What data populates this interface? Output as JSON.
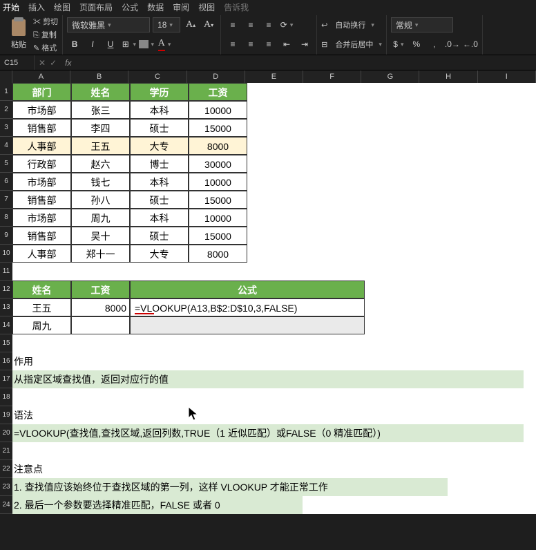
{
  "tabs": [
    "开始",
    "插入",
    "绘图",
    "页面布局",
    "公式",
    "数据",
    "审阅",
    "视图",
    "告诉我"
  ],
  "ribbon": {
    "paste": "粘贴",
    "cut": "剪切",
    "copy": "复制",
    "format": "格式",
    "font_name": "微软雅黑",
    "font_size": "18",
    "bold": "B",
    "italic": "I",
    "underline": "U",
    "autowrap": "自动换行",
    "merge": "合并后居中",
    "numfmt": "常规"
  },
  "namebox": "C15",
  "fx_label": "fx",
  "colheads": [
    "A",
    "B",
    "C",
    "D",
    "E",
    "F",
    "G",
    "H",
    "I"
  ],
  "table": {
    "headers": [
      "部门",
      "姓名",
      "学历",
      "工资"
    ],
    "rows": [
      [
        "市场部",
        "张三",
        "本科",
        "10000"
      ],
      [
        "销售部",
        "李四",
        "硕士",
        "15000"
      ],
      [
        "人事部",
        "王五",
        "大专",
        "8000"
      ],
      [
        "行政部",
        "赵六",
        "博士",
        "30000"
      ],
      [
        "市场部",
        "钱七",
        "本科",
        "10000"
      ],
      [
        "销售部",
        "孙八",
        "硕士",
        "15000"
      ],
      [
        "市场部",
        "周九",
        "本科",
        "10000"
      ],
      [
        "销售部",
        "吴十",
        "硕士",
        "15000"
      ],
      [
        "人事部",
        "郑十一",
        "大专",
        "8000"
      ]
    ],
    "highlight_index": 2
  },
  "lookup": {
    "headers": [
      "姓名",
      "工资",
      "公式"
    ],
    "rows": [
      {
        "name": "王五",
        "salary": "8000",
        "formula": "=VLOOKUP(A13,B$2:D$10,3,FALSE)"
      },
      {
        "name": "周九",
        "salary": "",
        "formula": ""
      }
    ]
  },
  "notes": {
    "l16": "作用",
    "l17": "从指定区域查找值，返回对应行的值",
    "l19": "语法",
    "l20": "=VLOOKUP(查找值,查找区域,返回列数,TRUE（1 近似匹配）或FALSE（0 精准匹配）)",
    "l22": "注意点",
    "l23": "1. 查找值应该始终位于查找区域的第一列，这样 VLOOKUP 才能正常工作",
    "l24": "2. 最后一个参数要选择精准匹配，FALSE 或者 0"
  }
}
